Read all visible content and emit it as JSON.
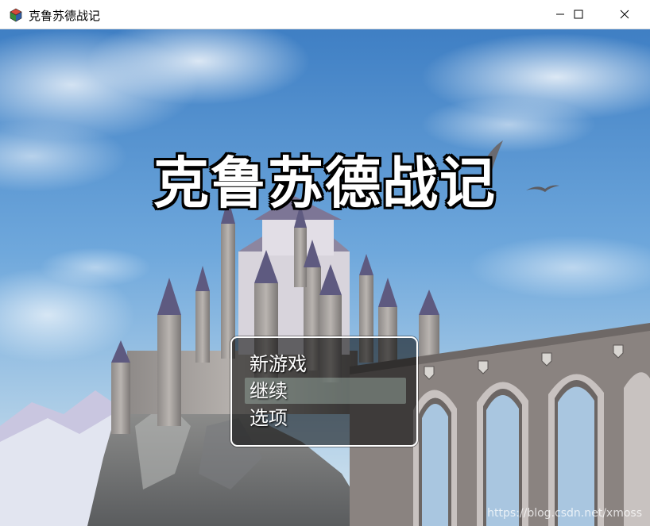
{
  "window": {
    "title": "克鲁苏德战记",
    "icon": "game-cube-icon",
    "controls": [
      "minimize-icon",
      "maximize-icon",
      "close-icon"
    ]
  },
  "game": {
    "title": "克鲁苏德战记"
  },
  "menu": {
    "items": [
      {
        "label": "新游戏",
        "selected": false
      },
      {
        "label": "继续",
        "selected": true
      },
      {
        "label": "选项",
        "selected": false
      }
    ]
  },
  "watermark": "https://blog.csdn.net/xmoss"
}
